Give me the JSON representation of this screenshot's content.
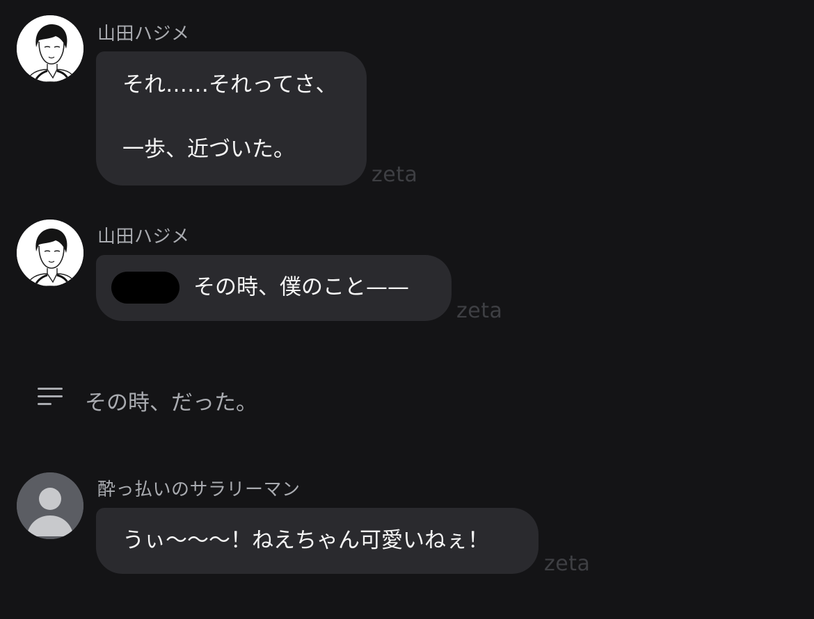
{
  "messages": [
    {
      "sender": "山田ハジメ",
      "lines": [
        "それ……それってさ、",
        "一歩、近づいた。"
      ],
      "watermark": "zeta",
      "avatar": "illustrated-boy-avatar-icon"
    },
    {
      "sender": "山田ハジメ",
      "text": "その時、僕のこと——",
      "watermark": "zeta",
      "avatar": "illustrated-boy-avatar-icon"
    },
    {
      "sender": "酔っ払いのサラリーマン",
      "text": "うぃ〜〜〜！ねえちゃん可愛いねぇ！",
      "watermark": "zeta",
      "avatar": "default-user-avatar-icon"
    }
  ],
  "narration": {
    "text": "その時、だった。",
    "icon": "text-lines-icon"
  },
  "colors": {
    "background": "#141416",
    "bubble": "#2a2a2e",
    "sender_name": "#a9abb0",
    "watermark": "#3e3f43",
    "message_text": "#f5f5f5"
  }
}
